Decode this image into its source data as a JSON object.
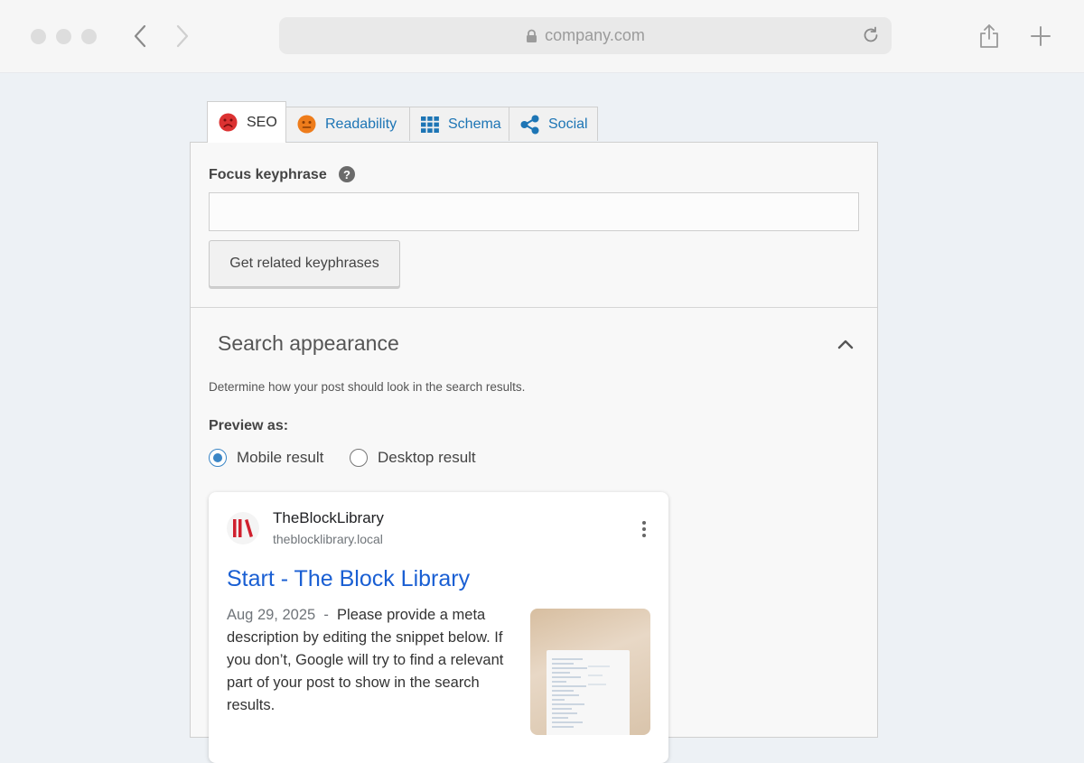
{
  "browser": {
    "url": "company.com"
  },
  "tabs": [
    {
      "label": "SEO",
      "icon": "sad-face-icon",
      "color": "#dc3232"
    },
    {
      "label": "Readability",
      "icon": "neutral-face-icon",
      "color": "#ee7c1b"
    },
    {
      "label": "Schema",
      "icon": "grid-icon",
      "color": "#1d75b5"
    },
    {
      "label": "Social",
      "icon": "share-icon",
      "color": "#1d75b5"
    }
  ],
  "focus_keyphrase": {
    "label": "Focus keyphrase",
    "help": "?",
    "value": "",
    "button_label": "Get related keyphrases"
  },
  "search_appearance": {
    "title": "Search appearance",
    "description": "Determine how your post should look in the search results.",
    "preview_label": "Preview as:",
    "options": [
      {
        "label": "Mobile result",
        "selected": true
      },
      {
        "label": "Desktop result",
        "selected": false
      }
    ]
  },
  "snippet": {
    "site_name": "TheBlockLibrary",
    "site_url": "theblocklibrary.local",
    "title": "Start - The Block Library",
    "date": "Aug 29, 2025",
    "separator": "-",
    "text": "Please provide a meta description by editing the snippet below. If you don’t, Google will try to find a relevant part of your post to show in the search results.",
    "logo_color": "#d0202e",
    "link_color": "#1a5fd3"
  }
}
